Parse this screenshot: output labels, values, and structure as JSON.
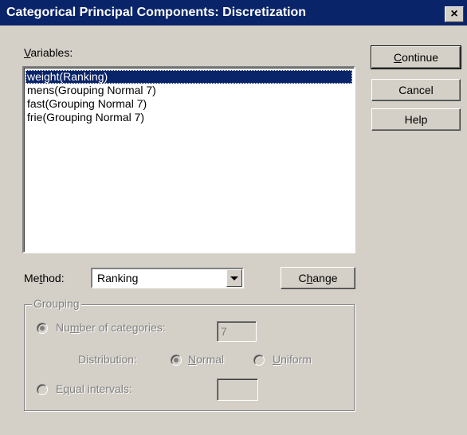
{
  "window": {
    "title": "Categorical Principal Components: Discretization",
    "close_glyph": "×"
  },
  "variables": {
    "label_key": "V",
    "label_rest": "ariables:",
    "items": [
      "weight(Ranking)",
      "mens(Grouping Normal 7)",
      "fast(Grouping Normal 7)",
      "frie(Grouping Normal 7)"
    ],
    "selected_index": 0
  },
  "buttons": {
    "continue_key": "C",
    "continue_rest": "ontinue",
    "cancel": "Cancel",
    "help": "Help",
    "change_pre": "C",
    "change_key": "h",
    "change_rest": "ange"
  },
  "method": {
    "label_pre": "Me",
    "label_key": "t",
    "label_rest": "hod:",
    "value": "Ranking"
  },
  "grouping": {
    "legend": "Grouping",
    "num_categories_pre": "Nu",
    "num_categories_key": "m",
    "num_categories_rest": "ber of categories:",
    "num_categories_value": "7",
    "distribution_label": "Distribution:",
    "normal_key": "N",
    "normal_rest": "ormal",
    "uniform_key": "U",
    "uniform_rest": "niform",
    "equal_pre": "E",
    "equal_key": "q",
    "equal_rest": "ual intervals:",
    "equal_value": ""
  },
  "colors": {
    "titlebar": "#0a246a",
    "face": "#d4d0c8",
    "disabled_text": "#808080"
  }
}
